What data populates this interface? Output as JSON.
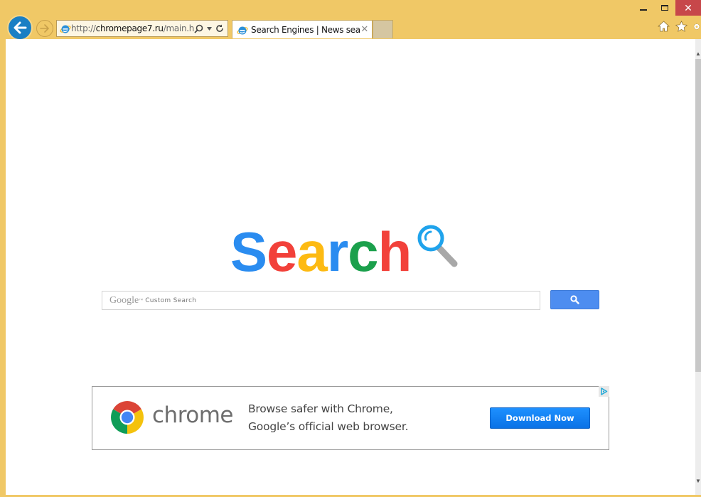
{
  "browser": {
    "window_controls": {
      "minimize": "minimize",
      "maximize": "maximize",
      "close": "✕"
    },
    "address_bar": {
      "url_prefix": "http://",
      "url_domain": "chromepage7.ru",
      "url_path": "/main.h"
    },
    "tabs": [
      {
        "title": "Search Engines | News search",
        "close": "✕"
      }
    ],
    "toolbar_icons": [
      "home-icon",
      "favorites-star-icon",
      "settings-gear-icon"
    ]
  },
  "page": {
    "logo": {
      "letters": [
        {
          "char": "S",
          "color": "#2A8CF0"
        },
        {
          "char": "e",
          "color": "#F2413A"
        },
        {
          "char": "a",
          "color": "#FDBA12"
        },
        {
          "char": "r",
          "color": "#2A8CF0"
        },
        {
          "char": "c",
          "color": "#1BA04C"
        },
        {
          "char": "h",
          "color": "#F2413A"
        }
      ],
      "magnifier_color": "#1FA3EC",
      "handle_color": "#A8A8A8"
    },
    "search": {
      "brand": "Google",
      "tm": "™",
      "placeholder": "Custom Search",
      "button_color": "#4D8DF0"
    },
    "ad": {
      "brand_word": "chrome",
      "line1": "Browse safer with Chrome,",
      "line2": "Google’s official web browser.",
      "cta": "Download Now"
    }
  }
}
